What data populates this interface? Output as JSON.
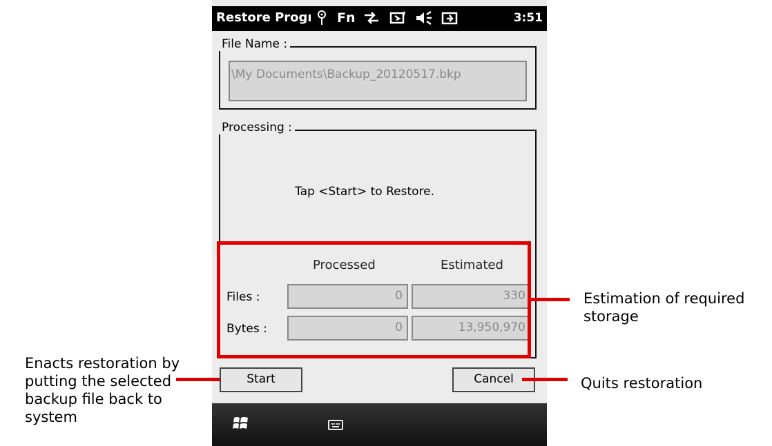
{
  "statusbar": {
    "title": "Restore Progı",
    "fn": "Fn",
    "clock": "3:51",
    "icons": [
      "antenna-icon",
      "data-sync-icon",
      "battery-charging-icon",
      "speaker-icon",
      "power-plug-icon"
    ]
  },
  "file_group": {
    "legend": "File Name :",
    "value": "\\My Documents\\Backup_20120517.bkp"
  },
  "processing_group": {
    "legend": "Processing :",
    "message": "Tap <Start> to Restore."
  },
  "stats": {
    "col_processed": "Processed",
    "col_estimated": "Estimated",
    "files_label": "Files :",
    "files_processed": "0",
    "files_estimated": "330",
    "bytes_label": "Bytes :",
    "bytes_processed": "0",
    "bytes_estimated": "13,950,970"
  },
  "buttons": {
    "start": "Start",
    "cancel": "Cancel"
  },
  "annotations": {
    "left": [
      "Enacts restoration by",
      "putting the selected",
      "backup file back to",
      "system"
    ],
    "estimation": [
      "Estimation of required",
      "storage"
    ],
    "quit": "Quits restoration"
  },
  "colors": {
    "highlight": "#e00000",
    "titlebar": "#000000",
    "dialog_bg": "#ececec",
    "field_bg": "#d7d7d7"
  }
}
